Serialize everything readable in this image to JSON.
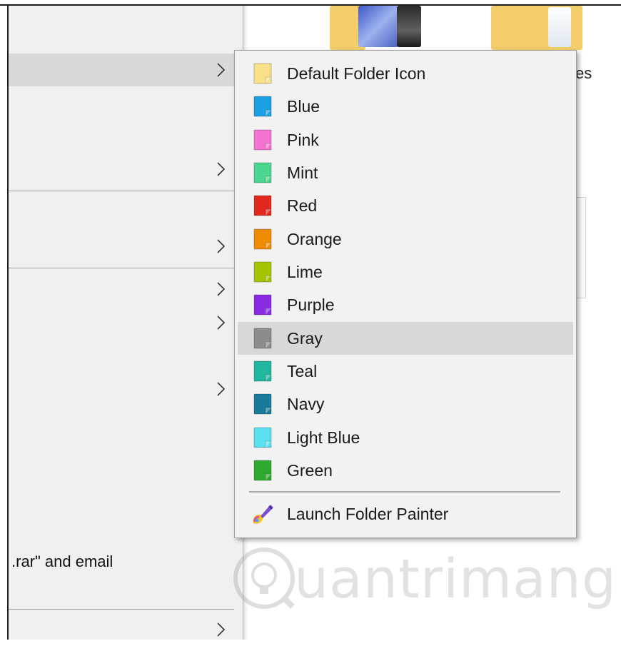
{
  "parent_menu": {
    "partial_text": ".rar\" and email"
  },
  "background": {
    "partial_label": "es"
  },
  "watermark": {
    "text": "uantrimang"
  },
  "submenu": {
    "items": [
      {
        "label": "Default Folder Icon",
        "color": "#fbe08a",
        "icon": "default-folder-icon"
      },
      {
        "label": "Blue",
        "color": "#1ba1e2",
        "icon": "blue-folder-icon"
      },
      {
        "label": "Pink",
        "color": "#f472d0",
        "icon": "pink-folder-icon"
      },
      {
        "label": "Mint",
        "color": "#4cd58f",
        "icon": "mint-folder-icon"
      },
      {
        "label": "Red",
        "color": "#e0281e",
        "icon": "red-folder-icon"
      },
      {
        "label": "Orange",
        "color": "#f08c00",
        "icon": "orange-folder-icon"
      },
      {
        "label": "Lime",
        "color": "#a4c400",
        "icon": "lime-folder-icon"
      },
      {
        "label": "Purple",
        "color": "#8a2be2",
        "icon": "purple-folder-icon"
      },
      {
        "label": "Gray",
        "color": "#8c8c8c",
        "icon": "gray-folder-icon"
      },
      {
        "label": "Teal",
        "color": "#22b8a0",
        "icon": "teal-folder-icon"
      },
      {
        "label": "Navy",
        "color": "#1a7a9a",
        "icon": "navy-folder-icon"
      },
      {
        "label": "Light Blue",
        "color": "#5ce0f0",
        "icon": "light-blue-folder-icon"
      },
      {
        "label": "Green",
        "color": "#2ea82e",
        "icon": "green-folder-icon"
      }
    ],
    "hover_item": "Gray",
    "launch": {
      "label": "Launch Folder Painter",
      "icon": "paint-brush-icon"
    }
  }
}
